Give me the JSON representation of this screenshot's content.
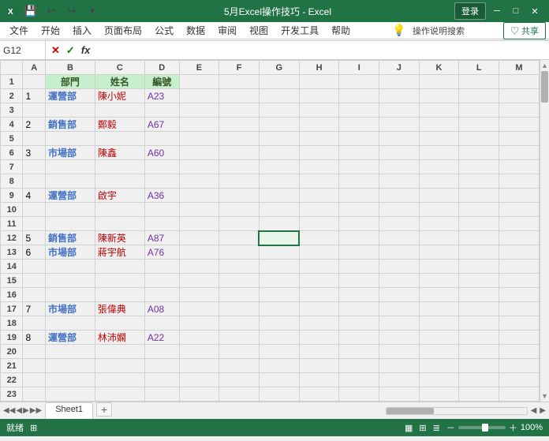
{
  "titleBar": {
    "title": "5月Excel操作技巧 - Excel",
    "loginLabel": "登录",
    "undoIcon": "↩",
    "redoIcon": "↪",
    "saveIcon": "💾",
    "minIcon": "─",
    "maxIcon": "□",
    "closeIcon": "✕"
  },
  "menuBar": {
    "items": [
      "文件",
      "开始",
      "插入",
      "页面布局",
      "公式",
      "数据",
      "审阅",
      "视图",
      "开发工具",
      "帮助"
    ]
  },
  "toolbar": {
    "helpText": "操作说明搜索",
    "shareLabel": "♡ 共享"
  },
  "formulaBar": {
    "cellRef": "G12",
    "cancelBtn": "✕",
    "confirmBtn": "✓",
    "funcBtn": "fx"
  },
  "columns": {
    "headers": [
      "",
      "A",
      "B",
      "C",
      "D",
      "E",
      "F",
      "G",
      "H",
      "I",
      "J",
      "K",
      "L",
      "M"
    ],
    "widths": [
      30,
      30,
      60,
      60,
      40,
      50,
      50,
      50,
      50,
      50,
      50,
      50,
      50,
      50
    ]
  },
  "rows": {
    "count": 23,
    "data": [
      {
        "row": 1,
        "cells": {
          "B": "部門",
          "C": "姓名",
          "D": "編號"
        },
        "isHeader": true
      },
      {
        "row": 2,
        "cells": {
          "B": "運營部",
          "C": "陳小妮",
          "D": "A23"
        }
      },
      {
        "row": 3,
        "cells": {}
      },
      {
        "row": 4,
        "cells": {
          "B": "銷售部",
          "C": "鄭毅",
          "D": "A67"
        }
      },
      {
        "row": 5,
        "cells": {}
      },
      {
        "row": 6,
        "cells": {
          "B": "市場部",
          "C": "陳鑫",
          "D": "A60"
        }
      },
      {
        "row": 7,
        "cells": {}
      },
      {
        "row": 8,
        "cells": {}
      },
      {
        "row": 9,
        "cells": {
          "B": "運營部",
          "C": "啟宇",
          "D": "A36"
        }
      },
      {
        "row": 10,
        "cells": {}
      },
      {
        "row": 11,
        "cells": {}
      },
      {
        "row": 12,
        "cells": {
          "B": "銷售部",
          "C": "陳新英",
          "D": "A87"
        }
      },
      {
        "row": 13,
        "cells": {
          "B": "市場部",
          "C": "蔣宇航",
          "D": "A76"
        }
      },
      {
        "row": 14,
        "cells": {}
      },
      {
        "row": 15,
        "cells": {}
      },
      {
        "row": 16,
        "cells": {}
      },
      {
        "row": 17,
        "cells": {
          "B": "市場部",
          "C": "張偉典",
          "D": "A08"
        }
      },
      {
        "row": 18,
        "cells": {}
      },
      {
        "row": 19,
        "cells": {
          "B": "運營部",
          "C": "林沛嫻",
          "D": "A22"
        }
      },
      {
        "row": 20,
        "cells": {}
      },
      {
        "row": 21,
        "cells": {}
      },
      {
        "row": 22,
        "cells": {}
      },
      {
        "row": 23,
        "cells": {}
      }
    ],
    "rowNumbers": {
      "2": "1",
      "4": "2",
      "6": "3",
      "9": "4",
      "12": "5",
      "13": "6",
      "17": "7",
      "19": "8"
    }
  },
  "tabs": {
    "sheets": [
      "Sheet1"
    ],
    "addLabel": "+"
  },
  "statusBar": {
    "left": "就绪",
    "macroIcon": "⊞",
    "zoomPercent": "100%"
  }
}
